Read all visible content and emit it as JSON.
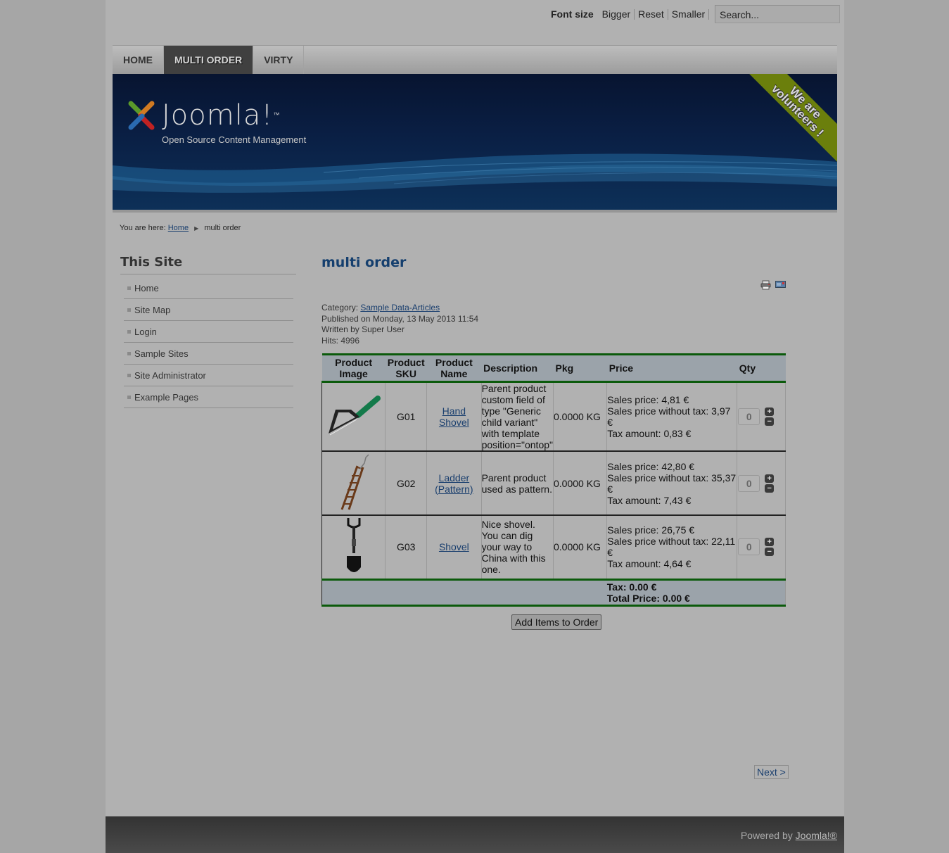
{
  "topbar": {
    "font_size_label": "Font size",
    "bigger": "Bigger",
    "reset": "Reset",
    "smaller": "Smaller",
    "search_placeholder": "Search..."
  },
  "nav": {
    "items": [
      {
        "label": "HOME",
        "active": false
      },
      {
        "label": "MULTI ORDER",
        "active": true
      },
      {
        "label": "VIRTY",
        "active": false
      }
    ]
  },
  "banner": {
    "logo_text": "Joomla!",
    "trademark": "™",
    "tagline": "Open Source Content Management",
    "ribbon_line1": "We are",
    "ribbon_line2": "volunteers !"
  },
  "breadcrumb": {
    "prefix": "You are here:",
    "home": "Home",
    "current": "multi order"
  },
  "sidebar": {
    "title": "This Site",
    "items": [
      {
        "label": "Home"
      },
      {
        "label": "Site Map"
      },
      {
        "label": "Login"
      },
      {
        "label": "Sample Sites"
      },
      {
        "label": "Site Administrator"
      },
      {
        "label": "Example Pages"
      }
    ]
  },
  "article": {
    "title": "multi order",
    "category_label": "Category:",
    "category": "Sample Data-Articles",
    "published": "Published on Monday, 13 May 2013 11:54",
    "written_by": "Written by Super User",
    "hits": "Hits: 4996"
  },
  "table": {
    "headers": {
      "image": "Product Image",
      "sku": "Product SKU",
      "name": "Product Name",
      "description": "Description",
      "pkg": "Pkg",
      "price": "Price",
      "qty": "Qty"
    },
    "rows": [
      {
        "image": "hand-shovel",
        "sku": "G01",
        "name": "Hand Shovel",
        "description": "Parent product custom field of type \"Generic child variant\" with template position=\"ontop\"",
        "pkg": "0.0000 KG",
        "sales_price": "Sales price: 4,81 €",
        "price_without_tax": "Sales price without tax: 3,97 €",
        "tax_amount": "Tax amount: 0,83 €",
        "qty": "0"
      },
      {
        "image": "ladder",
        "sku": "G02",
        "name": "Ladder (Pattern)",
        "description": "Parent product used as pattern.",
        "pkg": "0.0000 KG",
        "sales_price": "Sales price: 42,80 €",
        "price_without_tax": "Sales price without tax: 35,37 €",
        "tax_amount": "Tax amount: 7,43 €",
        "qty": "0"
      },
      {
        "image": "shovel",
        "sku": "G03",
        "name": "Shovel",
        "description": "Nice shovel. You can dig your way to China with this one.",
        "pkg": "0.0000 KG",
        "sales_price": "Sales price: 26,75 €",
        "price_without_tax": "Sales price without tax: 22,11 €",
        "tax_amount": "Tax amount: 4,64 €",
        "qty": "0"
      }
    ],
    "footer": {
      "tax": "Tax: 0.00 €",
      "total": "Total Price: 0.00 €"
    }
  },
  "add_button": "Add Items to Order",
  "pagination": {
    "next": "Next >"
  },
  "footer": {
    "powered_by": "Powered by",
    "link": "Joomla!®"
  },
  "colors": {
    "accent_green": "#0b5a0b",
    "link_blue": "#1a3f6e",
    "ribbon_green": "#6b7f0c",
    "banner_blue": "#0a1f44"
  }
}
